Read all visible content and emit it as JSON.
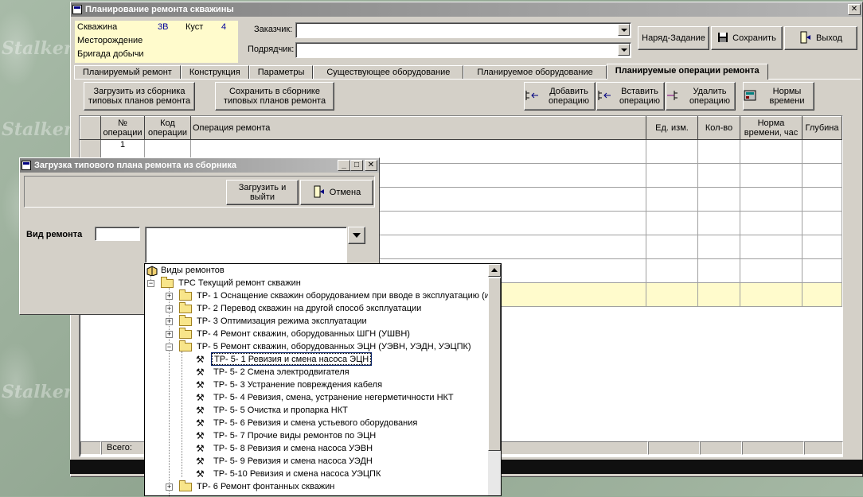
{
  "main_window": {
    "title": "Планирование ремонта скважины",
    "info": {
      "well_label": "Скважина",
      "well_value": "3В",
      "cluster_label": "Куст",
      "cluster_value": "4",
      "field_label": "Месторождение",
      "brigade_label": "Бригада добычи"
    },
    "customer_label": "Заказчик:",
    "customer_value": "",
    "contractor_label": "Подрядчик:",
    "contractor_value": "",
    "buttons": {
      "work_order": "Наряд-Задание",
      "save": "Сохранить",
      "exit": "Выход"
    },
    "tabs": [
      {
        "label": "Планируемый ремонт"
      },
      {
        "label": "Конструкция"
      },
      {
        "label": "Параметры"
      },
      {
        "label": "Существующее оборудование"
      },
      {
        "label": "Планируемое оборудование"
      },
      {
        "label": "Планируемые операции ремонта"
      }
    ],
    "toolbar": {
      "load_plan": "Загрузить из сборника типовых планов ремонта",
      "save_plan": "Сохранить в сборнике типовых планов ремонта",
      "add_op": "Добавить операцию",
      "insert_op": "Вставить операцию",
      "delete_op": "Удалить операцию",
      "time_norms": "Нормы времени"
    },
    "grid": {
      "columns": [
        "№ операции",
        "Код операции",
        "Операция ремонта",
        "Ед. изм.",
        "Кол-во",
        "Норма времени, час",
        "Глубина"
      ],
      "rows": [
        {
          "num": "1",
          "code": "",
          "op": "",
          "unit": "",
          "qty": "",
          "norm": "",
          "depth": ""
        }
      ],
      "total_label": "Всего:"
    }
  },
  "dialog": {
    "title": "Загрузка типового плана ремонта из сборника",
    "load_exit": "Загрузить и выйти",
    "cancel": "Отмена",
    "repair_type_label": "Вид ремонта",
    "repair_type_code": "",
    "repair_type_name": ""
  },
  "tree": {
    "root": "Виды ремонтов",
    "group": "ТРС Текущий ремонт скважин",
    "items": [
      "ТР- 1 Оснащение скважин оборудованием при вводе в эксплуатацию (и",
      "ТР- 2 Перевод скважин на другой способ эксплуатации",
      "ТР- 3 Оптимизация режима эксплуатации",
      "ТР- 4 Ремонт скважин, оборудованных ШГН (УШВН)",
      "ТР- 5 Ремонт скважин, оборудованных  ЭЦН (УЭВН, УЭДН, УЭЦПК)"
    ],
    "subitems": [
      "ТР- 5- 1 Ревизия и смена насоса ЭЦН",
      "ТР- 5- 2 Смена электродвигателя",
      "ТР- 5- 3 Устранение повреждения кабеля",
      "ТР- 5- 4 Ревизия, смена, устранение негерметичности НКТ",
      "ТР- 5- 5 Очистка и пропарка НКТ",
      "ТР- 5- 6 Ревизия и смена устьевого оборудования",
      "ТР- 5- 7 Прочие виды ремонтов по ЭЦН",
      "ТР- 5- 8 Ревизия и смена насоса УЭВН",
      "ТР- 5- 9 Ревизия и смена насоса УЭДН",
      "ТР- 5-10 Ревизия и смена насоса  УЭЦПК"
    ],
    "after": "ТР- 6 Ремонт фонтанных скважин"
  },
  "watermark": "Stalker",
  "colors": {
    "info_bg": "#fffbcc",
    "selected_row": "#fffbcc",
    "title_bar": "#808080"
  }
}
